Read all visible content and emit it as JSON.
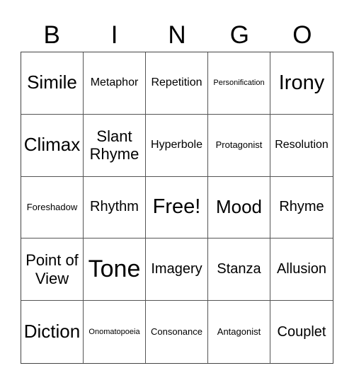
{
  "header": [
    "B",
    "I",
    "N",
    "G",
    "O"
  ],
  "cells": [
    {
      "text": "Simile",
      "size": "s-ml"
    },
    {
      "text": "Metaphor",
      "size": "s-s"
    },
    {
      "text": "Repetition",
      "size": "s-s"
    },
    {
      "text": "Personification",
      "size": "s-xxs"
    },
    {
      "text": "Irony",
      "size": "s-l"
    },
    {
      "text": "Climax",
      "size": "s-ml"
    },
    {
      "text": "Slant Rhyme",
      "size": "s-m"
    },
    {
      "text": "Hyperbole",
      "size": "s-s"
    },
    {
      "text": "Protagonist",
      "size": "s-xs"
    },
    {
      "text": "Resolution",
      "size": "s-s"
    },
    {
      "text": "Foreshadow",
      "size": "s-xs"
    },
    {
      "text": "Rhythm",
      "size": "s-sm"
    },
    {
      "text": "Free!",
      "size": "s-l"
    },
    {
      "text": "Mood",
      "size": "s-ml"
    },
    {
      "text": "Rhyme",
      "size": "s-sm"
    },
    {
      "text": "Point of View",
      "size": "s-m"
    },
    {
      "text": "Tone",
      "size": "s-xl"
    },
    {
      "text": "Imagery",
      "size": "s-sm"
    },
    {
      "text": "Stanza",
      "size": "s-sm"
    },
    {
      "text": "Allusion",
      "size": "s-sm"
    },
    {
      "text": "Diction",
      "size": "s-ml"
    },
    {
      "text": "Onomatopoeia",
      "size": "s-xxs"
    },
    {
      "text": "Consonance",
      "size": "s-xs"
    },
    {
      "text": "Antagonist",
      "size": "s-xs"
    },
    {
      "text": "Couplet",
      "size": "s-sm"
    }
  ]
}
